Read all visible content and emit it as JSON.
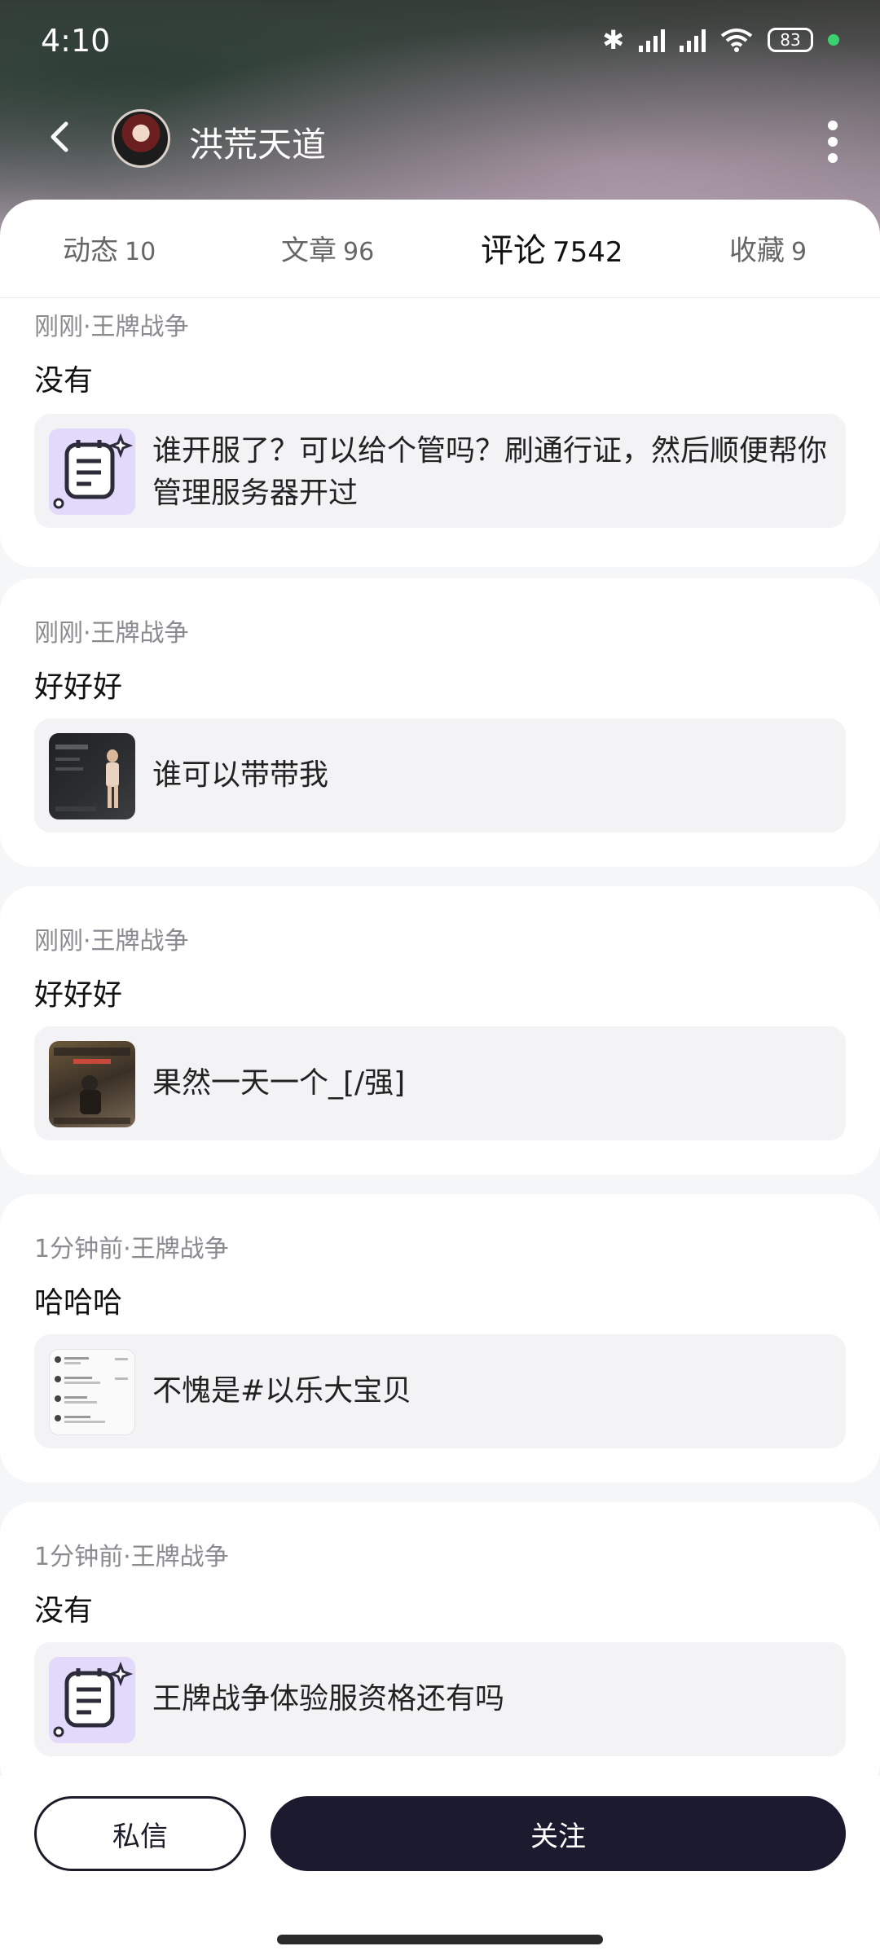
{
  "status": {
    "time": "4:10",
    "battery": "83"
  },
  "profile": {
    "name": "洪荒天道"
  },
  "tabs": [
    {
      "label": "动态",
      "count": "10"
    },
    {
      "label": "文章",
      "count": "96"
    },
    {
      "label": "评论",
      "count": "7542"
    },
    {
      "label": "收藏",
      "count": "9"
    }
  ],
  "comments": [
    {
      "meta": "刚刚·王牌战争",
      "text": "没有",
      "quote": "谁开服了？可以给个管吗？刷通行证，然后顺便帮你管理服务器开过",
      "thumb": "note-icon"
    },
    {
      "meta": "刚刚·王牌战争",
      "text": "好好好",
      "quote": "谁可以带带我",
      "thumb": "game-screenshot"
    },
    {
      "meta": "刚刚·王牌战争",
      "text": "好好好",
      "quote": "果然一天一个_[/强]",
      "thumb": "game-screenshot"
    },
    {
      "meta": "1分钟前·王牌战争",
      "text": "哈哈哈",
      "quote": "不愧是#以乐大宝贝",
      "thumb": "document-screenshot"
    },
    {
      "meta": "1分钟前·王牌战争",
      "text": "没有",
      "quote": "王牌战争体验服资格还有吗",
      "thumb": "note-icon"
    }
  ],
  "actions": {
    "message": "私信",
    "follow": "关注"
  },
  "colors": {
    "accent": "#b9a6f3",
    "follow_bg": "#1b1a2e"
  }
}
